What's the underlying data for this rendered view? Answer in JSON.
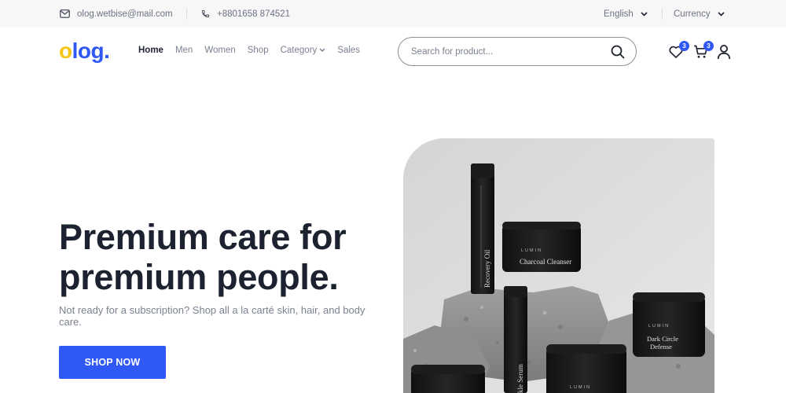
{
  "topbar": {
    "email": "olog.wetbise@mail.com",
    "phone": "+8801658 874521",
    "language": "English",
    "currency": "Currency"
  },
  "header": {
    "logo_first": "o",
    "logo_rest": "log.",
    "nav": [
      "Home",
      "Men",
      "Women",
      "Shop",
      "Category",
      "Sales"
    ],
    "active_nav": "Home",
    "search_placeholder": "Search for product...",
    "wishlist_count": "3",
    "cart_count": "3"
  },
  "hero": {
    "title": "Premium care for premium people.",
    "subtitle": "Not ready for a subscription? Shop all a la carté skin, hair, and body care.",
    "cta_label": "SHOP NOW",
    "products": {
      "brand": "LUMIN",
      "charcoal": "Charcoal Cleanser",
      "recovery": "Recovery Oil",
      "dark_circle_line1": "Dark Circle",
      "dark_circle_line2": "Defense",
      "serum": "kle Serum"
    }
  },
  "colors": {
    "accent": "#2f58f5",
    "logo_yellow": "#f5c518",
    "topbar_bg": "#f7f7f8"
  }
}
